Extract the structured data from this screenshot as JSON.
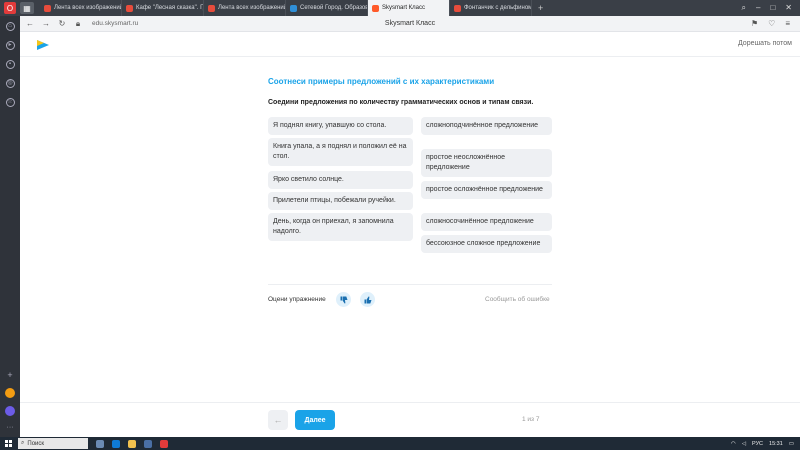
{
  "browser": {
    "tabs": [
      {
        "label": "Лента всех изображений",
        "color": "#e74c3c"
      },
      {
        "label": "Кафе \"Лесная сказка\". Где",
        "color": "#e74c3c"
      },
      {
        "label": "Лента всех изображений",
        "color": "#e74c3c"
      },
      {
        "label": "Сетевой Город. Образов",
        "color": "#2f8fd8"
      },
      {
        "label": "Skysmart Класс",
        "color": "#ff5a2a"
      },
      {
        "label": "Фонтанчик с дельфином",
        "color": "#e74c3c"
      }
    ],
    "url": "edu.skysmart.ru",
    "page_title": "Skysmart Класс"
  },
  "header": {
    "later_label": "Дорешать потом"
  },
  "exercise": {
    "heading": "Соотнеси примеры предложений с их характеристиками",
    "instruction": "Соедини предложения по количеству грамматических основ и типам связи.",
    "left": [
      "Я поднял книгу, упавшую со стола.",
      "Книга упала, а я поднял и положил её на стол.",
      "Ярко светило солнце.",
      "Прилетели птицы, побежали ручейки.",
      "День, когда он приехал, я запомнила надолго."
    ],
    "right": [
      "сложноподчинённое предложение",
      "простое неосложнённое предложение",
      "простое осложнённое предложение",
      "сложносочинённое предложение",
      "бессоюзное сложное предложение"
    ]
  },
  "rating": {
    "label": "Оцени упражнение",
    "report": "Сообщить об ошибке"
  },
  "nav": {
    "back": "←",
    "next": "Далее",
    "pager": "1 из 7"
  },
  "taskbar": {
    "search": "Поиск",
    "lang": "РУС",
    "time": "15:31"
  }
}
